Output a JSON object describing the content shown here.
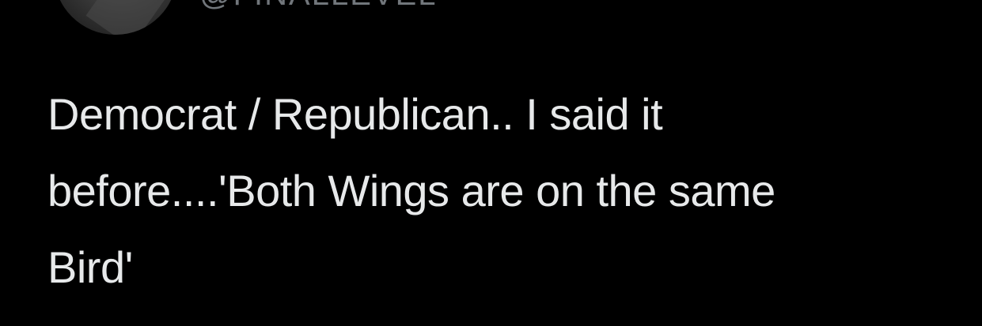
{
  "tweet": {
    "handle": "@FINALLEVEL",
    "text_lines": [
      "Democrat / Republican.. I said it",
      "before....'Both Wings are on the same",
      "Bird'"
    ]
  },
  "colors": {
    "background": "#000000",
    "text": "#e7e9ea",
    "handle": "#71767b"
  }
}
